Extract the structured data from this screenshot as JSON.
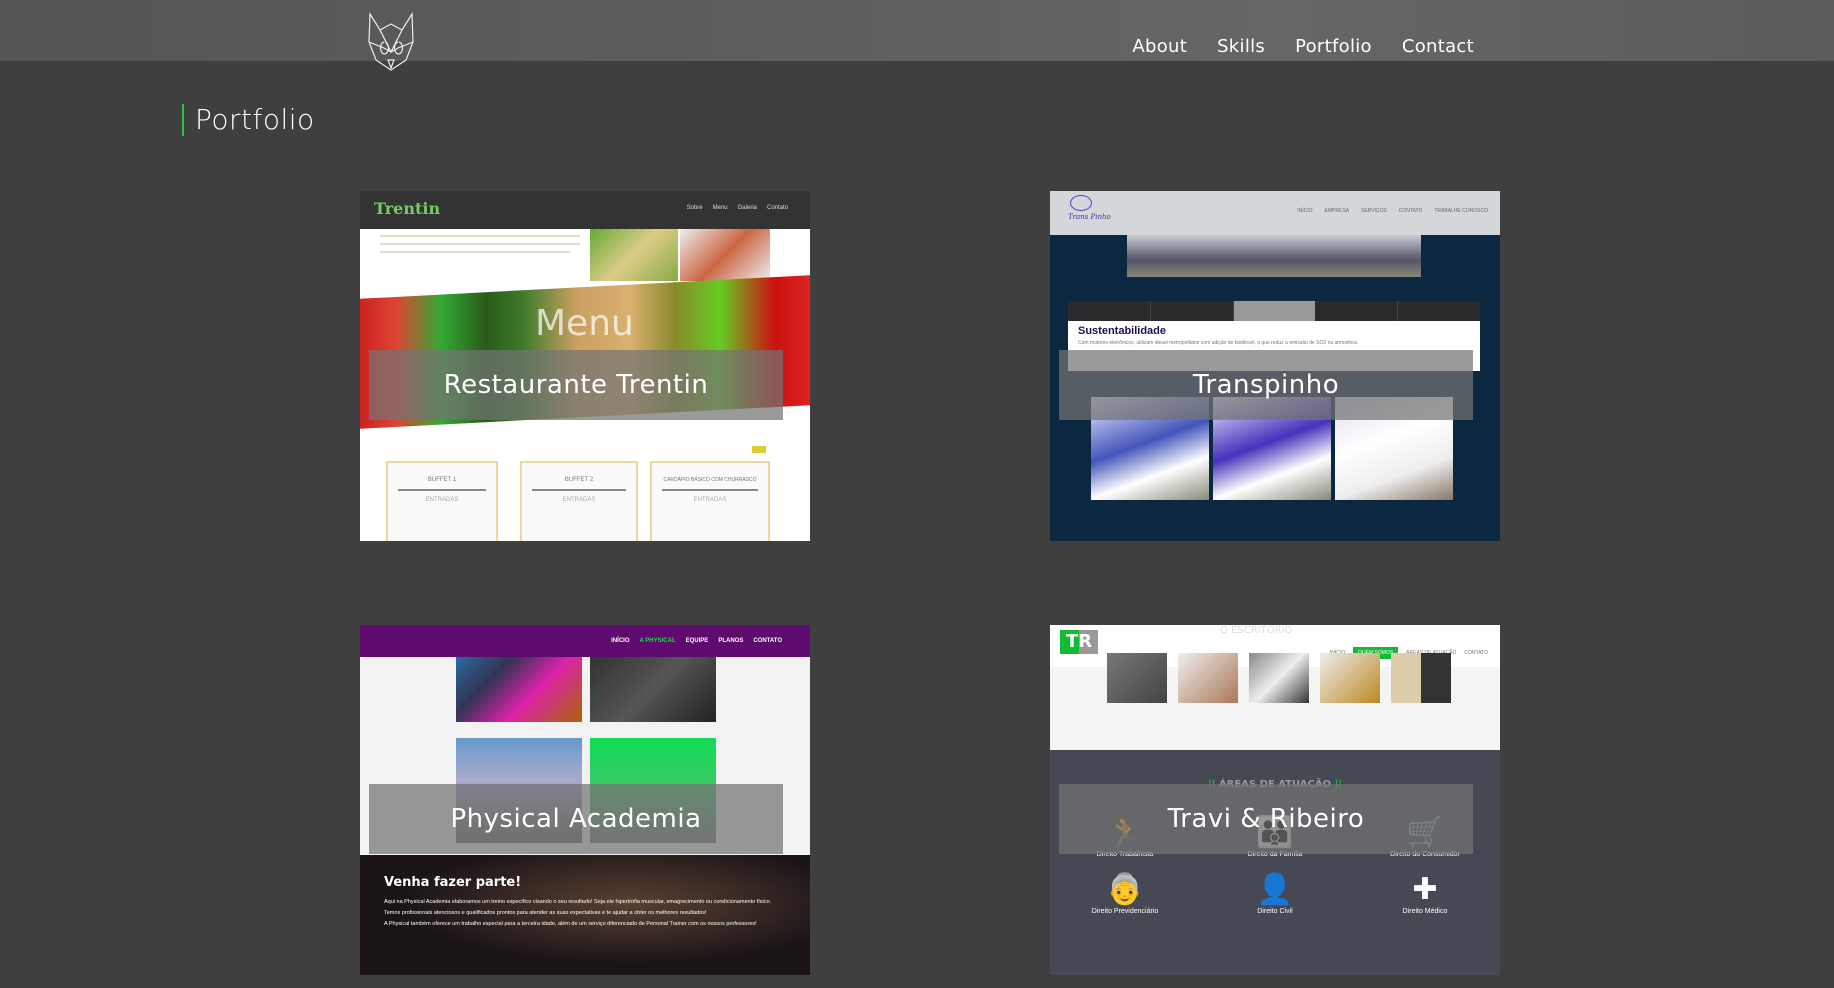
{
  "header": {
    "logo": "wolf-logo",
    "nav": [
      "About",
      "Skills",
      "Portfolio",
      "Contact"
    ]
  },
  "page_title": "Portfolio",
  "accent": "#27c24c",
  "projects": [
    {
      "title": "Restaurante Trentin",
      "preview": {
        "logo": "Trentin",
        "nav": [
          "Sobre",
          "Menu",
          "Galeria",
          "Contato"
        ],
        "hero": "Menu",
        "menus": [
          "BUFFET 1",
          "BUFFET 2",
          "CARDÁPIO BÁSICO COM CHURRASCO"
        ],
        "menu_sub": "ENTRADAS"
      }
    },
    {
      "title": "Transpinho",
      "preview": {
        "logo": "Trans Pinho",
        "nav": [
          "INÍCIO",
          "EMPRESA",
          "SERVIÇOS",
          "CONTATO",
          "TRABALHE CONOSCO"
        ],
        "heading": "Sustentabilidade",
        "text": "Com motores eletrônicos, utilizam diesel metropolitano com adição de biodiesel, o que reduz a emissão de SO2 na atmosfera."
      }
    },
    {
      "title": "Physical Academia",
      "preview": {
        "nav": [
          "INÍCIO",
          "A PHYSICAL",
          "EQUIPE",
          "PLANOS",
          "CONTATO"
        ],
        "heading": "Venha fazer parte!",
        "paragraphs": [
          "Aqui na Physical Academia elaboramos um treino específico visando o seu resultado! Seja ele hipertrofia muscular, emagrecimento ou condicionamento físico.",
          "Temos profissionais atenciosos e qualificados prontos para atender as suas expectativas e te ajudar a obter os melhores resultados!",
          "A Physical também oferece um trabalho especial para a terceira idade, além de um serviço diferenciado de Personal Trainer com os nossos professores!"
        ]
      }
    },
    {
      "title": "Travi & Ribeiro",
      "preview": {
        "logo": "TR",
        "section_top": "O ESCRITÓRIO",
        "nav": [
          "INÍCIO",
          "QUEM SOMOS",
          "ÁREAS DE ATUAÇÃO",
          "CONTATO"
        ],
        "section": "ÁREAS DE ATUAÇÃO",
        "areas": [
          "Direito Trabalhista",
          "Direito da Família",
          "Direito do Consumidor",
          "Direito Previdenciário",
          "Direito Civil",
          "Direito Médico"
        ]
      }
    }
  ]
}
